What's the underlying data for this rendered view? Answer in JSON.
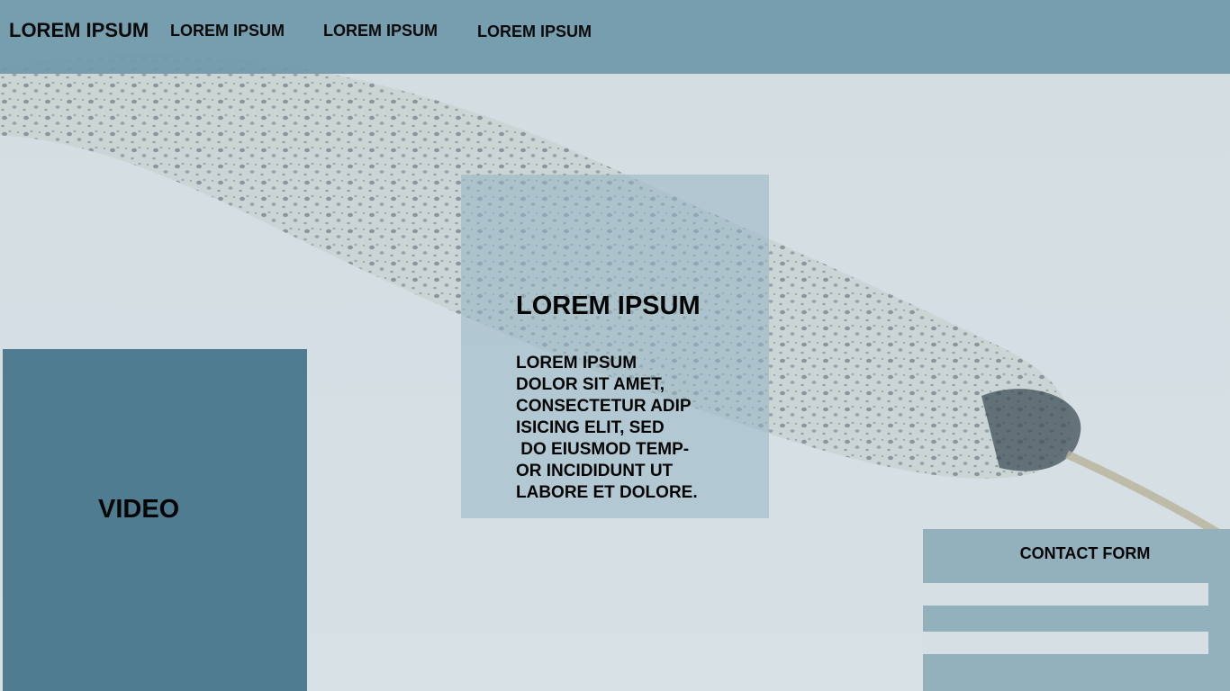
{
  "nav": {
    "brand": "LOREM IPSUM",
    "items": [
      "LOREM IPSUM",
      "LOREM IPSUM",
      "LOREM IPSUM"
    ]
  },
  "hero": {
    "title": "LOREM IPSUM",
    "body": "LOREM IPSUM\nDOLOR SIT AMET,\nCONSECTETUR ADIP\nISICING ELIT, SED\n DO EIUSMOD TEMP-\nOR INCIDIDUNT UT\nLABORE ET DOLORE."
  },
  "video": {
    "label": "VIDEO"
  },
  "contact": {
    "title": "CONTACT FORM",
    "field1_value": "",
    "field2_value": ""
  },
  "colors": {
    "navbar": "#6e98aa",
    "video_panel": "#4f7c90",
    "contact_panel": "#93b0bd",
    "background": "#d4dee3"
  },
  "icons": {
    "background_image": "narwhal-photo"
  }
}
